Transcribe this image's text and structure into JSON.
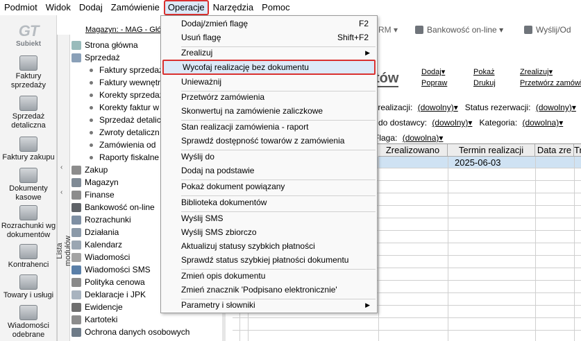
{
  "menubar": [
    "Podmiot",
    "Widok",
    "Dodaj",
    "Zamówienie",
    "Operacje",
    "Narzędzia",
    "Pomoc"
  ],
  "logo": "Subiekt",
  "leftbar": [
    "Faktury sprzedaży",
    "Sprzedaż detaliczna",
    "Faktury zakupu",
    "Dokumenty kasowe",
    "Rozrachunki wg dokumentów",
    "Kontrahenci",
    "Towary i usługi",
    "Wiadomości odebrane"
  ],
  "toolbar": {
    "magazyn": "Magazyn: - MAG - Głó",
    "rm": "RM",
    "bank": "Bankowość on-line",
    "send": "Wyślij/Od"
  },
  "tree": {
    "label": "Lista modułów",
    "top": [
      "Strona główna",
      "Sprzedaż"
    ],
    "sprzedaz_children": [
      "Faktury sprzedaż",
      "Faktury wewnętr",
      "Korekty sprzedaż",
      "Korekty faktur w",
      "Sprzedaż detalicz",
      "Zwroty detaliczn",
      "Zamówienia od",
      "Raporty fiskalne"
    ],
    "modules": [
      "Zakup",
      "Magazyn",
      "Finanse",
      "Bankowość on-line",
      "Rozrachunki",
      "Działania",
      "Kalendarz",
      "Wiadomości",
      "Wiadomości SMS",
      "Polityka cenowa",
      "Deklaracje i JPK",
      "Ewidencje",
      "Kartoteki",
      "Ochrona danych osobowych"
    ]
  },
  "main": {
    "title": "tów",
    "links": {
      "dodaj": "Dodaj",
      "popraw": "Popraw",
      "pokaz": "Pokaż",
      "drukuj": "Drukuj",
      "zrealizuj": "Zrealizuj",
      "przetworz": "Przetwórz zamówie"
    },
    "filters": {
      "status_realizacji": "s realizacji:",
      "status_realizacji_val": "(dowolny)",
      "status_rezerwacji": "Status rezerwacji:",
      "status_rezerwacji_val": "(dowolny)",
      "do_dostawcy": "e do dostawcy:",
      "do_dostawcy_val": "(dowolny)",
      "kategoria": "Kategoria:",
      "kategoria_val": "(dowolna)",
      "flaga": "Flaga:",
      "flaga_val": "(dowolna)"
    },
    "columns": [
      "Zrealizowano",
      "Termin realizacji",
      "Data zre",
      "Tr"
    ],
    "row1_termin": "2025-06-03"
  },
  "dropdown": {
    "items": [
      {
        "label": "Dodaj/zmień flagę",
        "shortcut": "F2"
      },
      {
        "label": "Usuń flagę",
        "shortcut": "Shift+F2"
      },
      {
        "label": "Zrealizuj",
        "shortcut": ""
      },
      {
        "label": "Wycofaj realizację bez dokumentu",
        "shortcut": ""
      },
      {
        "label": "Unieważnij",
        "shortcut": ""
      },
      {
        "label": "Przetwórz zamówienia",
        "shortcut": ""
      },
      {
        "label": "Skonwertuj na zamówienie zaliczkowe",
        "shortcut": ""
      },
      {
        "label": "Stan realizacji zamówienia - raport",
        "shortcut": ""
      },
      {
        "label": "Sprawdź dostępność towarów z zamówienia",
        "shortcut": ""
      },
      {
        "label": "Wyślij do",
        "shortcut": ""
      },
      {
        "label": "Dodaj na podstawie",
        "shortcut": ""
      },
      {
        "label": "Pokaż dokument powiązany",
        "shortcut": ""
      },
      {
        "label": "Biblioteka dokumentów",
        "shortcut": ""
      },
      {
        "label": "Wyślij SMS",
        "shortcut": ""
      },
      {
        "label": "Wyślij SMS zbiorczo",
        "shortcut": ""
      },
      {
        "label": "Aktualizuj statusy szybkich płatności",
        "shortcut": ""
      },
      {
        "label": "Sprawdź status szybkiej płatności dokumentu",
        "shortcut": ""
      },
      {
        "label": "Zmień opis dokumentu",
        "shortcut": ""
      },
      {
        "label": "Zmień znacznik 'Podpisano elektronicznie'",
        "shortcut": ""
      },
      {
        "label": "Parametry i słowniki",
        "shortcut": ""
      }
    ]
  },
  "colors": {
    "highlight_border": "#d9302f",
    "highlight_bg": "#dce9f8",
    "row_selected": "#cfe2f3"
  }
}
